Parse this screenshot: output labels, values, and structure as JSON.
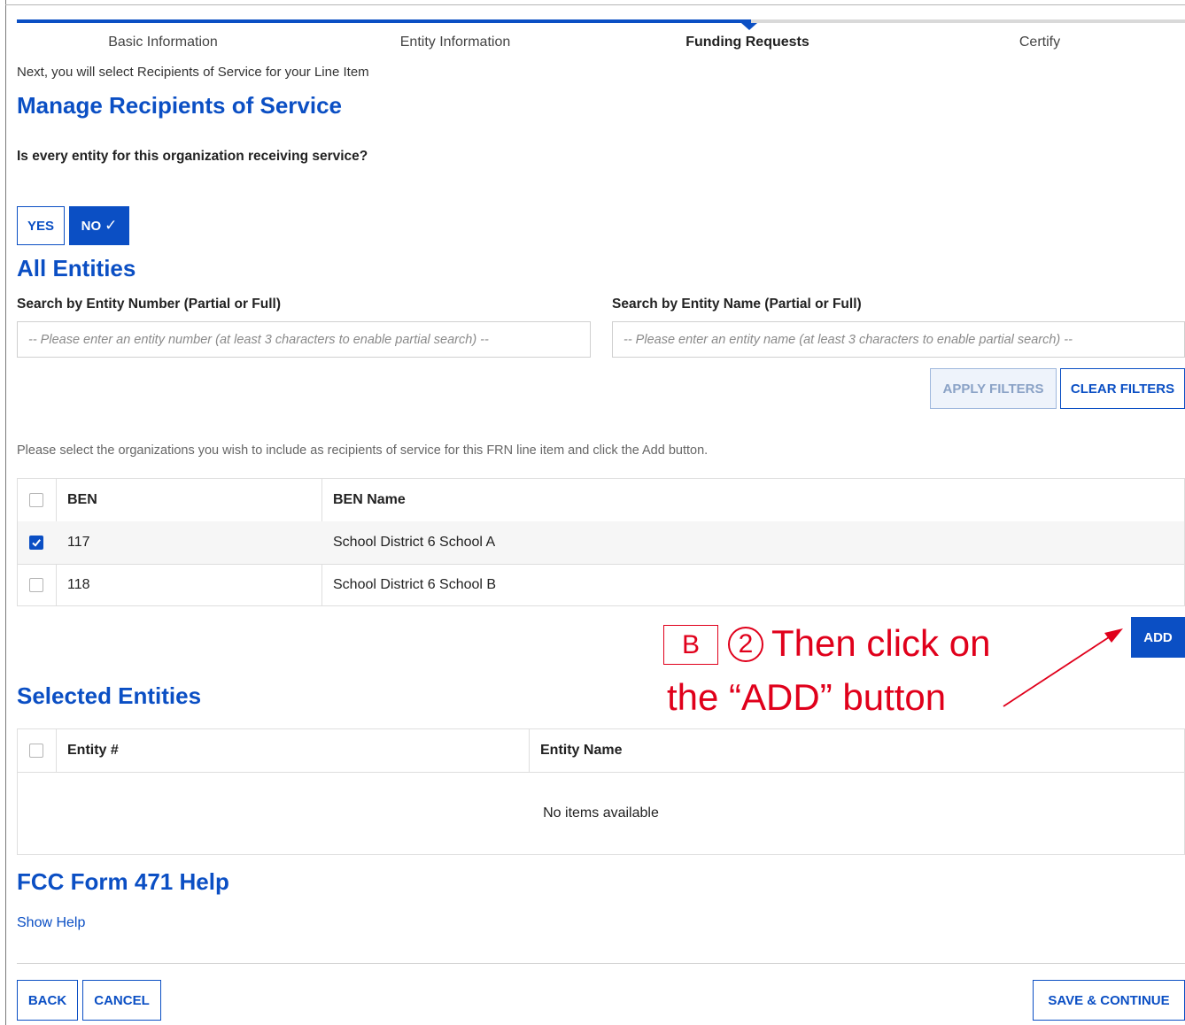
{
  "progress": {
    "steps": [
      "Basic Information",
      "Entity Information",
      "Funding Requests",
      "Certify"
    ],
    "active_step": "Funding Requests"
  },
  "intro_text": "Next, you will select Recipients of Service for your Line Item",
  "manage": {
    "title": "Manage Recipients of Service",
    "question": "Is every entity for this organization receiving service?",
    "yes_label": "YES",
    "no_label": "NO",
    "no_check": "✓",
    "selected_answer": "NO"
  },
  "all_entities": {
    "title": "All Entities",
    "search_number_label": "Search by Entity Number (Partial or Full)",
    "search_number_placeholder": "-- Please enter an entity number (at least 3 characters to enable partial search) --",
    "search_name_label": "Search by Entity Name (Partial or Full)",
    "search_name_placeholder": "-- Please enter an entity name (at least 3 characters to enable partial search) --",
    "apply_filters": "APPLY FILTERS",
    "clear_filters": "CLEAR FILTERS",
    "instructions": "Please select the organizations you wish to include as recipients of service for this FRN line item and click the Add button.",
    "columns": [
      "BEN",
      "BEN Name"
    ],
    "rows": [
      {
        "ben": "117",
        "name": "School District 6 School A",
        "checked": true
      },
      {
        "ben": "118",
        "name": "School District 6 School B",
        "checked": false
      }
    ],
    "add_button": "ADD"
  },
  "annotation": {
    "box_letter": "B",
    "step_number": "2",
    "line1": "Then click on",
    "line2": "the “ADD” button",
    "color": "#e0001b"
  },
  "selected_entities": {
    "title": "Selected Entities",
    "columns": [
      "Entity #",
      "Entity Name"
    ],
    "empty_text": "No items available"
  },
  "help": {
    "title": "FCC Form 471 Help",
    "show_help": "Show Help"
  },
  "footer": {
    "back": "BACK",
    "cancel": "CANCEL",
    "save_continue": "SAVE & CONTINUE"
  },
  "colors": {
    "brand_blue": "#0b4fc4",
    "annotation_red": "#e0001b"
  }
}
